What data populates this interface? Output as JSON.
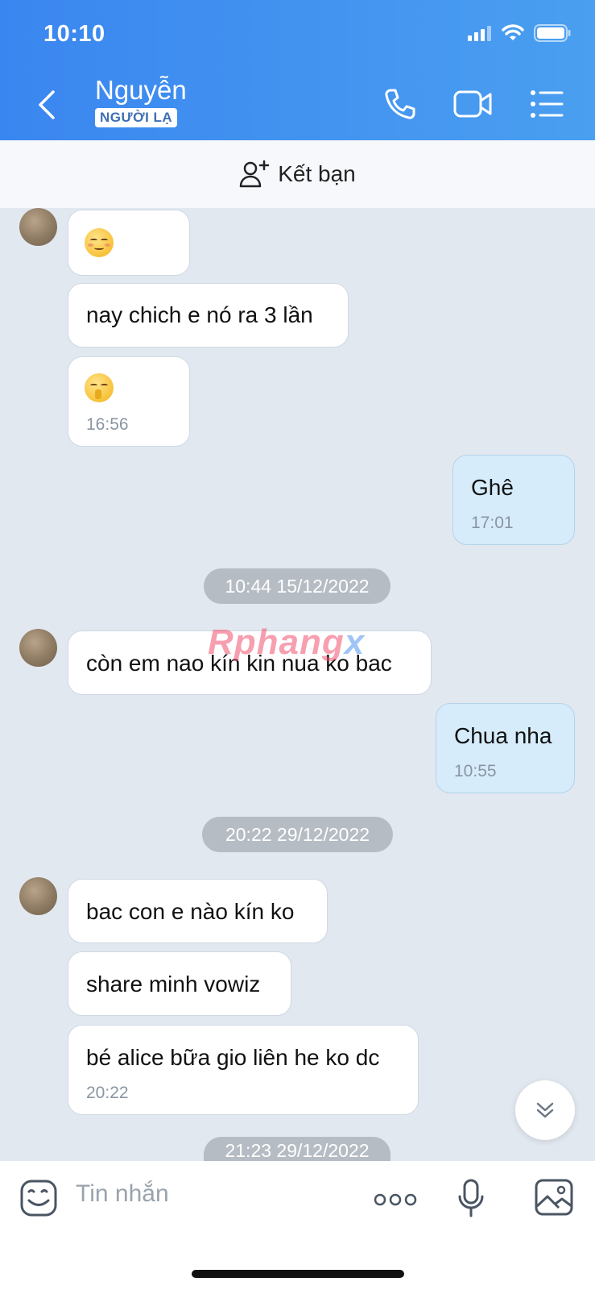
{
  "status_bar": {
    "time": "10:10"
  },
  "header": {
    "name": "Nguyễn",
    "badge": "NGƯỜI LẠ"
  },
  "add_friend": {
    "label": "Kết bạn"
  },
  "messages": [
    {
      "text": "nay chich e nó ra 3 lần"
    },
    {
      "time": "16:56"
    },
    {
      "text": "Ghê",
      "time": "17:01"
    },
    {
      "text": "còn em nao kín kin nua ko bac"
    },
    {
      "text": "Chua nha",
      "time": "10:55"
    },
    {
      "text": "bac con e nào kín ko"
    },
    {
      "text": "share minh vowiz"
    },
    {
      "text": "bé alice bữa gio liên he ko dc",
      "time": "20:22"
    }
  ],
  "date_separators": [
    "10:44 15/12/2022",
    "20:22 29/12/2022",
    "21:23 29/12/2022"
  ],
  "watermark": {
    "part1": "Rphang",
    "part2": "x"
  },
  "input": {
    "placeholder": "Tin nhắn"
  },
  "icons": {
    "header": [
      "back-icon",
      "phone-icon",
      "video-icon",
      "menu-icon"
    ],
    "input": [
      "sticker-icon",
      "more-icon",
      "mic-icon",
      "image-icon"
    ]
  },
  "colors": {
    "header": "#3a86f0",
    "outgoing_bubble": "#d6ecfb",
    "chat_bg": "#e2e8f0"
  }
}
